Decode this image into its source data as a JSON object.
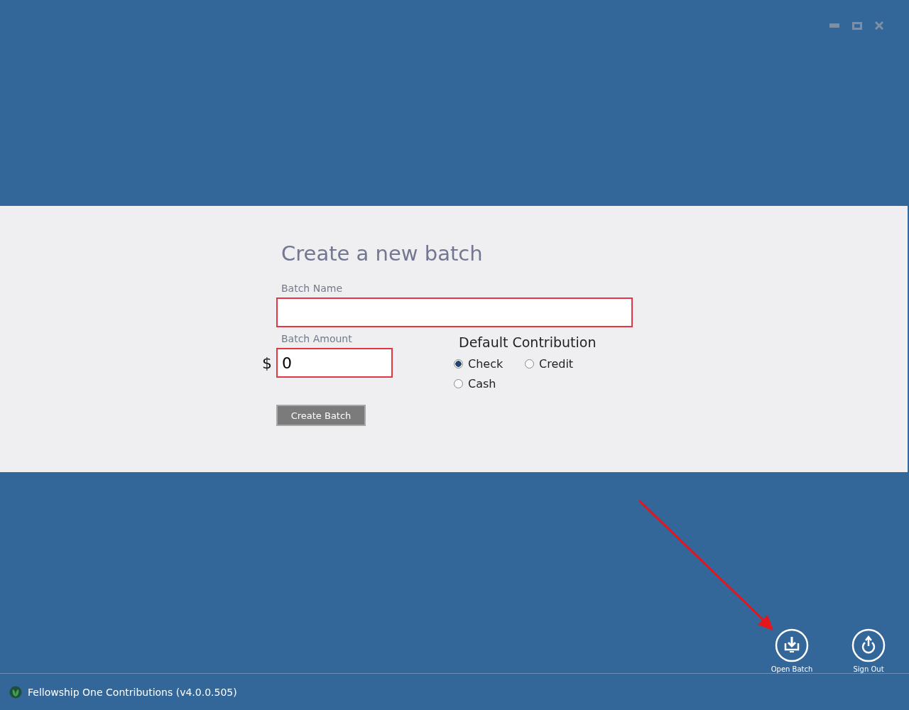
{
  "form": {
    "title": "Create a new batch",
    "batch_name": {
      "label": "Batch Name"
    },
    "batch_amount": {
      "label": "Batch Amount",
      "currency": "$",
      "value": "0"
    },
    "default_contribution": {
      "label": "Default Contribution",
      "options": [
        {
          "label": "Check",
          "selected": true
        },
        {
          "label": "Credit",
          "selected": false
        },
        {
          "label": "Cash",
          "selected": false
        }
      ]
    },
    "submit": "Create Batch"
  },
  "actions": [
    {
      "kind": "open",
      "label": "Open Batch"
    },
    {
      "kind": "signout",
      "label": "Sign Out"
    }
  ],
  "status_bar": {
    "text": "Fellowship One Contributions (v4.0.0.505)"
  }
}
